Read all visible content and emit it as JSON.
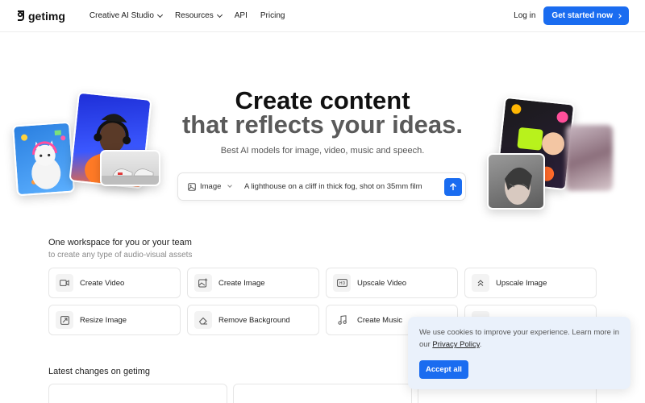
{
  "brand": {
    "name": "getimg",
    "accent": "#1a6cf0"
  },
  "nav": {
    "links": [
      {
        "label": "Creative AI Studio",
        "has_dropdown": true
      },
      {
        "label": "Resources",
        "has_dropdown": true
      },
      {
        "label": "API",
        "has_dropdown": false
      },
      {
        "label": "Pricing",
        "has_dropdown": false
      }
    ],
    "login": "Log in",
    "cta": "Get started now"
  },
  "hero": {
    "title_line1": "Create content",
    "title_line2": "that reflects your ideas.",
    "subtitle": "Best AI models for image, video, music and speech.",
    "prompt": {
      "mode": "Image",
      "value": "A lighthouse on a cliff in thick fog, shot on 35mm film"
    }
  },
  "workspace": {
    "title": "One workspace for you or your team",
    "subtitle": "to create any type of audio-visual assets",
    "tools": [
      {
        "label": "Create Video",
        "icon": "video-icon"
      },
      {
        "label": "Create Image",
        "icon": "image-plus-icon"
      },
      {
        "label": "Upscale Video",
        "icon": "hd-icon"
      },
      {
        "label": "Upscale Image",
        "icon": "upscale-icon"
      },
      {
        "label": "Resize Image",
        "icon": "resize-icon"
      },
      {
        "label": "Remove Background",
        "icon": "eraser-icon"
      },
      {
        "label": "Create Music",
        "icon": "music-icon"
      },
      {
        "label": "",
        "icon": "tool-icon"
      }
    ]
  },
  "changes": {
    "title": "Latest changes on getimg"
  },
  "cookie": {
    "text": "We use cookies to improve your experience. Learn more in our",
    "link": "Privacy Policy",
    "suffix": ".",
    "accept": "Accept all"
  }
}
